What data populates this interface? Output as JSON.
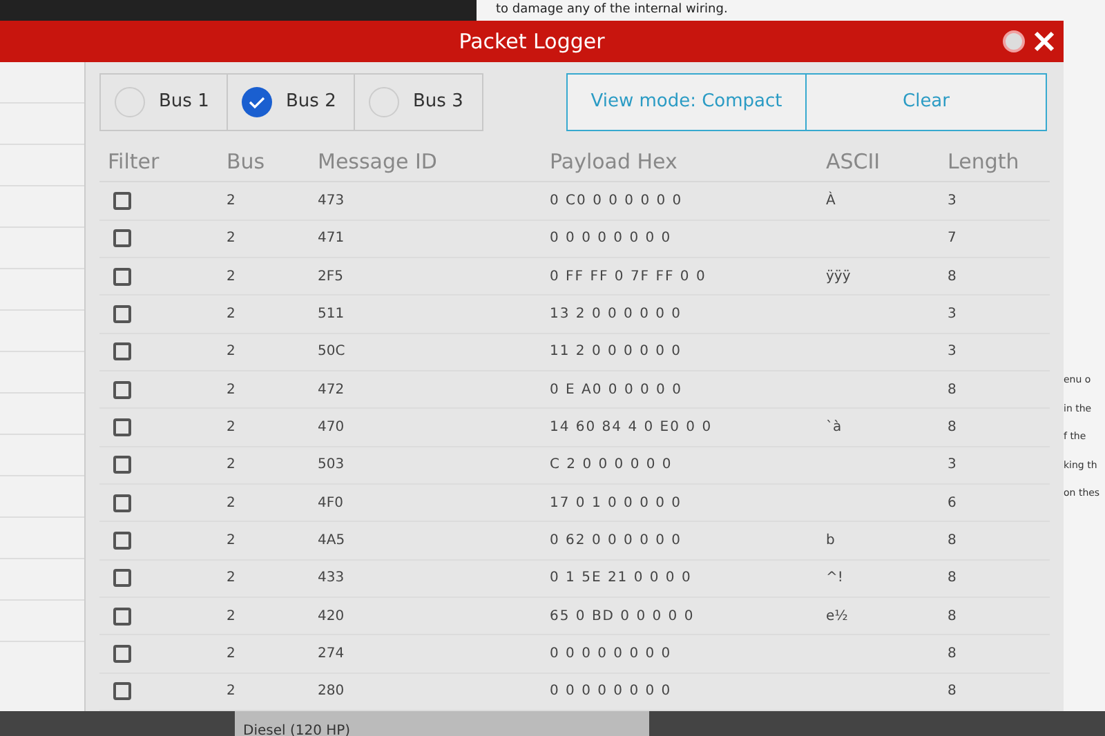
{
  "background": {
    "top_text": "to damage any of the internal wiring.",
    "side_texts": [
      "enu o",
      "in the",
      "f the",
      "king th",
      "on thes"
    ],
    "bottom_text": "Diesel (120 HP)"
  },
  "window": {
    "title": "Packet Logger"
  },
  "bus_options": [
    {
      "label": "Bus 1",
      "selected": false
    },
    {
      "label": "Bus 2",
      "selected": true
    },
    {
      "label": "Bus 3",
      "selected": false
    }
  ],
  "buttons": [
    "View mode: Compact",
    "Clear"
  ],
  "table": {
    "columns": [
      "Filter",
      "Bus",
      "Message ID",
      "Payload Hex",
      "ASCII",
      "Length"
    ],
    "rows": [
      {
        "checked": false,
        "bus": "2",
        "id": "473",
        "payload": "0 C0 0 0 0 0 0 0",
        "ascii": "À",
        "length": "3"
      },
      {
        "checked": false,
        "bus": "2",
        "id": "471",
        "payload": "0 0 0 0 0 0 0 0",
        "ascii": "",
        "length": "7"
      },
      {
        "checked": false,
        "bus": "2",
        "id": "2F5",
        "payload": "0 FF FF 0 7F FF 0 0",
        "ascii": "ÿÿÿ",
        "length": "8"
      },
      {
        "checked": false,
        "bus": "2",
        "id": "511",
        "payload": "13 2 0 0 0 0 0 0",
        "ascii": "",
        "length": "3"
      },
      {
        "checked": false,
        "bus": "2",
        "id": "50C",
        "payload": "11 2 0 0 0 0 0 0",
        "ascii": "",
        "length": "3"
      },
      {
        "checked": false,
        "bus": "2",
        "id": "472",
        "payload": "0 E A0 0 0 0 0 0",
        "ascii": "",
        "length": "8"
      },
      {
        "checked": false,
        "bus": "2",
        "id": "470",
        "payload": "14 60 84 4 0 E0 0 0",
        "ascii": "`à",
        "length": "8"
      },
      {
        "checked": false,
        "bus": "2",
        "id": "503",
        "payload": "C 2 0 0 0 0 0 0",
        "ascii": "",
        "length": "3"
      },
      {
        "checked": false,
        "bus": "2",
        "id": "4F0",
        "payload": "17 0 1 0 0 0 0 0",
        "ascii": "",
        "length": "6"
      },
      {
        "checked": false,
        "bus": "2",
        "id": "4A5",
        "payload": "0 62 0 0 0 0 0 0",
        "ascii": "b",
        "length": "8"
      },
      {
        "checked": false,
        "bus": "2",
        "id": "433",
        "payload": "0 1 5E 21 0 0 0 0",
        "ascii": "^!",
        "length": "8"
      },
      {
        "checked": false,
        "bus": "2",
        "id": "420",
        "payload": "65 0 BD 0 0 0 0 0",
        "ascii": "e½",
        "length": "8"
      },
      {
        "checked": false,
        "bus": "2",
        "id": "274",
        "payload": "0 0 0 0 0 0 0 0",
        "ascii": "",
        "length": "8"
      },
      {
        "checked": false,
        "bus": "2",
        "id": "280",
        "payload": "0 0 0 0 0 0 0 0",
        "ascii": "",
        "length": "8"
      }
    ]
  }
}
